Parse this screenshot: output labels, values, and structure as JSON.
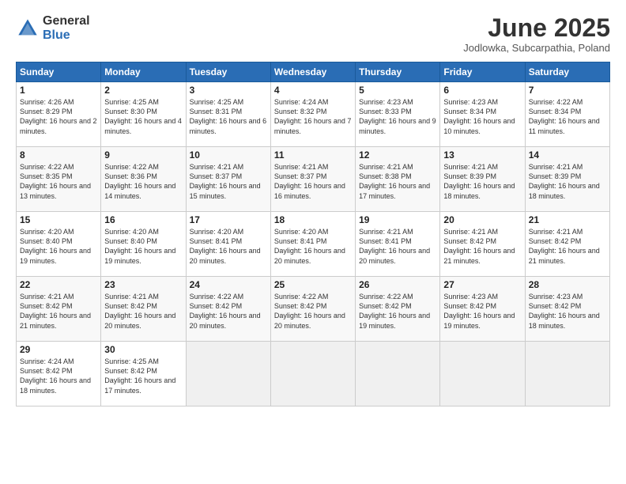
{
  "logo": {
    "general": "General",
    "blue": "Blue"
  },
  "title": "June 2025",
  "location": "Jodlowka, Subcarpathia, Poland",
  "days_of_week": [
    "Sunday",
    "Monday",
    "Tuesday",
    "Wednesday",
    "Thursday",
    "Friday",
    "Saturday"
  ],
  "weeks": [
    [
      {
        "day": 1,
        "sunrise": "4:26 AM",
        "sunset": "8:29 PM",
        "daylight": "16 hours and 2 minutes."
      },
      {
        "day": 2,
        "sunrise": "4:25 AM",
        "sunset": "8:30 PM",
        "daylight": "16 hours and 4 minutes."
      },
      {
        "day": 3,
        "sunrise": "4:25 AM",
        "sunset": "8:31 PM",
        "daylight": "16 hours and 6 minutes."
      },
      {
        "day": 4,
        "sunrise": "4:24 AM",
        "sunset": "8:32 PM",
        "daylight": "16 hours and 7 minutes."
      },
      {
        "day": 5,
        "sunrise": "4:23 AM",
        "sunset": "8:33 PM",
        "daylight": "16 hours and 9 minutes."
      },
      {
        "day": 6,
        "sunrise": "4:23 AM",
        "sunset": "8:34 PM",
        "daylight": "16 hours and 10 minutes."
      },
      {
        "day": 7,
        "sunrise": "4:22 AM",
        "sunset": "8:34 PM",
        "daylight": "16 hours and 11 minutes."
      }
    ],
    [
      {
        "day": 8,
        "sunrise": "4:22 AM",
        "sunset": "8:35 PM",
        "daylight": "16 hours and 13 minutes."
      },
      {
        "day": 9,
        "sunrise": "4:22 AM",
        "sunset": "8:36 PM",
        "daylight": "16 hours and 14 minutes."
      },
      {
        "day": 10,
        "sunrise": "4:21 AM",
        "sunset": "8:37 PM",
        "daylight": "16 hours and 15 minutes."
      },
      {
        "day": 11,
        "sunrise": "4:21 AM",
        "sunset": "8:37 PM",
        "daylight": "16 hours and 16 minutes."
      },
      {
        "day": 12,
        "sunrise": "4:21 AM",
        "sunset": "8:38 PM",
        "daylight": "16 hours and 17 minutes."
      },
      {
        "day": 13,
        "sunrise": "4:21 AM",
        "sunset": "8:39 PM",
        "daylight": "16 hours and 18 minutes."
      },
      {
        "day": 14,
        "sunrise": "4:21 AM",
        "sunset": "8:39 PM",
        "daylight": "16 hours and 18 minutes."
      }
    ],
    [
      {
        "day": 15,
        "sunrise": "4:20 AM",
        "sunset": "8:40 PM",
        "daylight": "16 hours and 19 minutes."
      },
      {
        "day": 16,
        "sunrise": "4:20 AM",
        "sunset": "8:40 PM",
        "daylight": "16 hours and 19 minutes."
      },
      {
        "day": 17,
        "sunrise": "4:20 AM",
        "sunset": "8:41 PM",
        "daylight": "16 hours and 20 minutes."
      },
      {
        "day": 18,
        "sunrise": "4:20 AM",
        "sunset": "8:41 PM",
        "daylight": "16 hours and 20 minutes."
      },
      {
        "day": 19,
        "sunrise": "4:21 AM",
        "sunset": "8:41 PM",
        "daylight": "16 hours and 20 minutes."
      },
      {
        "day": 20,
        "sunrise": "4:21 AM",
        "sunset": "8:42 PM",
        "daylight": "16 hours and 21 minutes."
      },
      {
        "day": 21,
        "sunrise": "4:21 AM",
        "sunset": "8:42 PM",
        "daylight": "16 hours and 21 minutes."
      }
    ],
    [
      {
        "day": 22,
        "sunrise": "4:21 AM",
        "sunset": "8:42 PM",
        "daylight": "16 hours and 21 minutes."
      },
      {
        "day": 23,
        "sunrise": "4:21 AM",
        "sunset": "8:42 PM",
        "daylight": "16 hours and 20 minutes."
      },
      {
        "day": 24,
        "sunrise": "4:22 AM",
        "sunset": "8:42 PM",
        "daylight": "16 hours and 20 minutes."
      },
      {
        "day": 25,
        "sunrise": "4:22 AM",
        "sunset": "8:42 PM",
        "daylight": "16 hours and 20 minutes."
      },
      {
        "day": 26,
        "sunrise": "4:22 AM",
        "sunset": "8:42 PM",
        "daylight": "16 hours and 19 minutes."
      },
      {
        "day": 27,
        "sunrise": "4:23 AM",
        "sunset": "8:42 PM",
        "daylight": "16 hours and 19 minutes."
      },
      {
        "day": 28,
        "sunrise": "4:23 AM",
        "sunset": "8:42 PM",
        "daylight": "16 hours and 18 minutes."
      }
    ],
    [
      {
        "day": 29,
        "sunrise": "4:24 AM",
        "sunset": "8:42 PM",
        "daylight": "16 hours and 18 minutes."
      },
      {
        "day": 30,
        "sunrise": "4:25 AM",
        "sunset": "8:42 PM",
        "daylight": "16 hours and 17 minutes."
      },
      null,
      null,
      null,
      null,
      null
    ]
  ]
}
